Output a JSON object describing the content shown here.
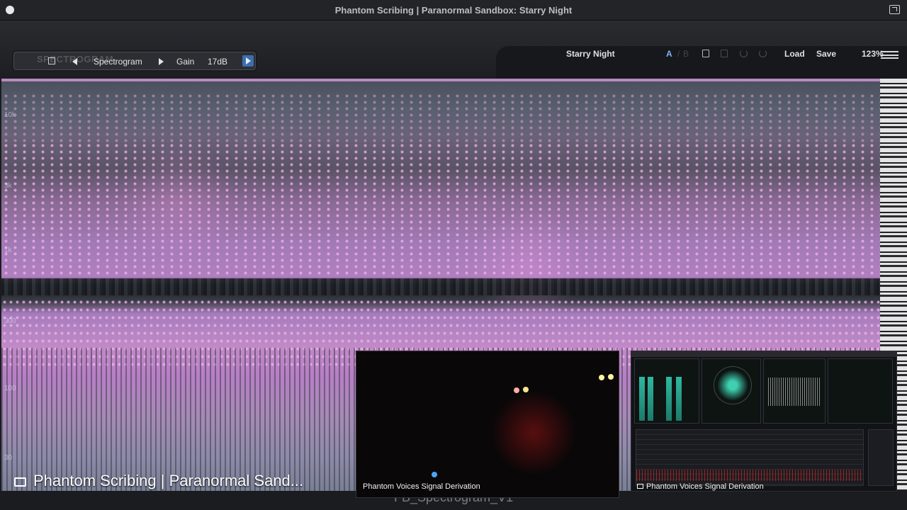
{
  "window": {
    "title": "Phantom Scribing | Paranormal Sandbox: Starry Night"
  },
  "panel": {
    "ghost_title": "SPECTROGRAM",
    "mode_label": "Spectrogram",
    "gain_label": "Gain",
    "gain_value": "17dB"
  },
  "toolbar": {
    "preset_name": "Starry Night",
    "ab_a": "A",
    "ab_b": "B",
    "load_label": "Load",
    "save_label": "Save",
    "zoom": "123%"
  },
  "spectrogram": {
    "freq_labels": [
      "10k",
      "3k",
      "1k",
      "300",
      "100",
      "30"
    ]
  },
  "overlay": {
    "main_caption": "Phantom Scribing | Paranormal Sand...",
    "bottom_label": "FB_Spectrogram_V1",
    "video_caption": "Phantom Voices Signal Derivation",
    "meter_caption": "Phantom Voices Signal Derivation"
  },
  "colors": {
    "accent": "#3a6fb0",
    "spectrum_pink": "#c08ac8",
    "meter_teal": "#2fb8a0",
    "meter_red": "#d22828"
  }
}
